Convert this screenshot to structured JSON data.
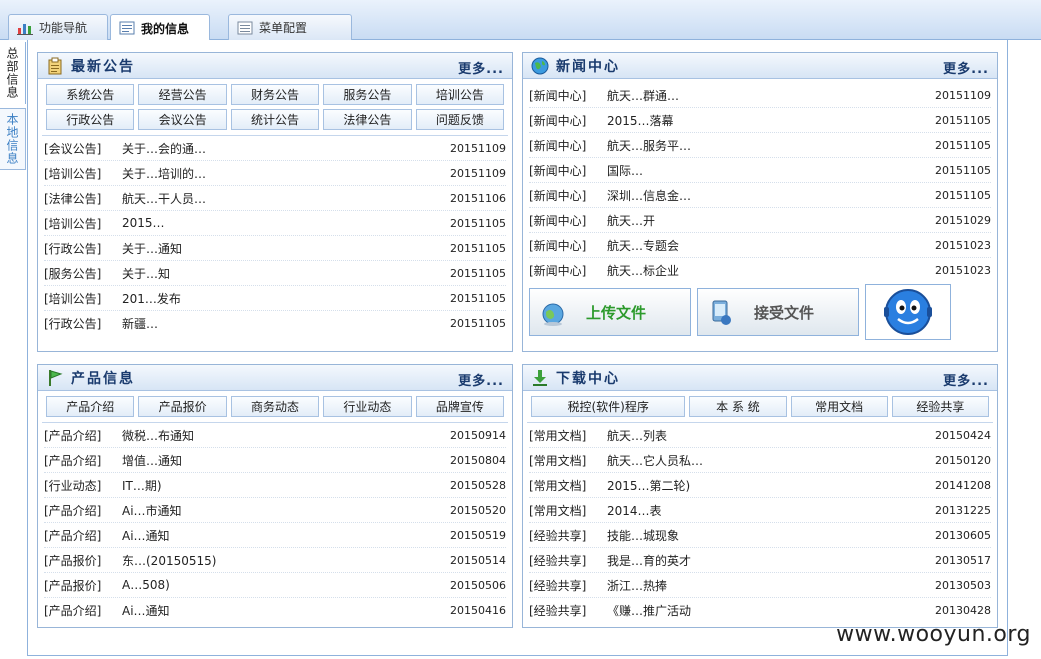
{
  "tabs": [
    {
      "label": "功能导航",
      "active": false
    },
    {
      "label": "我的信息",
      "active": true
    },
    {
      "label": "菜单配置",
      "active": false
    }
  ],
  "side_tabs": [
    "总部信息",
    "本地信息"
  ],
  "notices": {
    "title": "最新公告",
    "more": "更多...",
    "buttons_row1": [
      "系统公告",
      "经营公告",
      "财务公告",
      "服务公告",
      "培训公告"
    ],
    "buttons_row2": [
      "行政公告",
      "会议公告",
      "统计公告",
      "法律公告",
      "问题反馈"
    ],
    "rows": [
      {
        "cat": "[会议公告]",
        "title": "关于…会的通…",
        "date": "20151109"
      },
      {
        "cat": "[培训公告]",
        "title": "关于…培训的…",
        "date": "20151109"
      },
      {
        "cat": "[法律公告]",
        "title": "航天…干人员…",
        "date": "20151106"
      },
      {
        "cat": "[培训公告]",
        "title": "2015…",
        "date": "20151105"
      },
      {
        "cat": "[行政公告]",
        "title": "关于…通知",
        "date": "20151105"
      },
      {
        "cat": "[服务公告]",
        "title": "关于…知",
        "date": "20151105"
      },
      {
        "cat": "[培训公告]",
        "title": "201…发布",
        "date": "20151105"
      },
      {
        "cat": "[行政公告]",
        "title": "新疆…",
        "date": "20151105"
      }
    ]
  },
  "news": {
    "title": "新闻中心",
    "more": "更多...",
    "rows": [
      {
        "cat": "[新闻中心]",
        "title": "航天…群通…",
        "date": "20151109"
      },
      {
        "cat": "[新闻中心]",
        "title": "2015…落幕",
        "date": "20151105"
      },
      {
        "cat": "[新闻中心]",
        "title": "航天…服务平…",
        "date": "20151105"
      },
      {
        "cat": "[新闻中心]",
        "title": "国际…",
        "date": "20151105"
      },
      {
        "cat": "[新闻中心]",
        "title": "深圳…信息金…",
        "date": "20151105"
      },
      {
        "cat": "[新闻中心]",
        "title": "航天…开",
        "date": "20151029"
      },
      {
        "cat": "[新闻中心]",
        "title": "航天…专题会",
        "date": "20151023"
      },
      {
        "cat": "[新闻中心]",
        "title": "航天…标企业",
        "date": "20151023"
      }
    ],
    "upload_label": "上传文件",
    "receive_label": "接受文件"
  },
  "products": {
    "title": "产品信息",
    "more": "更多...",
    "buttons": [
      "产品介绍",
      "产品报价",
      "商务动态",
      "行业动态",
      "品牌宣传"
    ],
    "rows": [
      {
        "cat": "[产品介绍]",
        "title": "微税…布通知",
        "date": "20150914"
      },
      {
        "cat": "[产品介绍]",
        "title": "增值…通知",
        "date": "20150804"
      },
      {
        "cat": "[行业动态]",
        "title": "IT…期)",
        "date": "20150528"
      },
      {
        "cat": "[产品介绍]",
        "title": "Ai…市通知",
        "date": "20150520"
      },
      {
        "cat": "[产品介绍]",
        "title": "Ai…通知",
        "date": "20150519"
      },
      {
        "cat": "[产品报价]",
        "title": "东…(20150515)",
        "date": "20150514"
      },
      {
        "cat": "[产品报价]",
        "title": "A…508)",
        "date": "20150506"
      },
      {
        "cat": "[产品介绍]",
        "title": "Ai…通知",
        "date": "20150416"
      }
    ]
  },
  "downloads": {
    "title": "下载中心",
    "more": "更多...",
    "buttons": [
      "税控(软件)程序",
      "本 系 统",
      "常用文档",
      "经验共享"
    ],
    "rows": [
      {
        "cat": "[常用文档]",
        "title": "航天…列表",
        "date": "20150424"
      },
      {
        "cat": "[常用文档]",
        "title": "航天…它人员私…",
        "date": "20150120"
      },
      {
        "cat": "[常用文档]",
        "title": "2015…第二轮)",
        "date": "20141208"
      },
      {
        "cat": "[常用文档]",
        "title": "2014…表",
        "date": "20131225"
      },
      {
        "cat": "[经验共享]",
        "title": "技能…城现象",
        "date": "20130605"
      },
      {
        "cat": "[经验共享]",
        "title": "我是…育的英才",
        "date": "20130517"
      },
      {
        "cat": "[经验共享]",
        "title": "浙江…热捧",
        "date": "20130503"
      },
      {
        "cat": "[经验共享]",
        "title": "《赚…推广活动",
        "date": "20130428"
      }
    ]
  },
  "watermark": "www.wooyun.org",
  "colors": {
    "accent": "#1a3b6e",
    "border": "#98b5d8",
    "upload_green": "#2c9a2c"
  }
}
